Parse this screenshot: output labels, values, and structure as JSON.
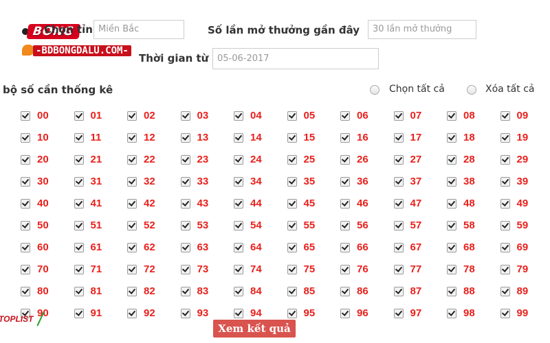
{
  "logo": {
    "brand": "BONG",
    "site": "-BDBONGDALU.COM-"
  },
  "form": {
    "province_label": "Chọn tỉnh",
    "province_value": "Miền Bắc",
    "draws_label": "Số lần mở thưởng gần đây",
    "draws_value": "30 lần mở thưởng",
    "from_label": "Thời gian từ",
    "from_value": "05-06-2017"
  },
  "numbers_section": {
    "title": "bộ số cần thống kê",
    "select_all": "Chọn tất cả",
    "clear_all": "Xóa tất cả"
  },
  "numbers": [
    "00",
    "01",
    "02",
    "03",
    "04",
    "05",
    "06",
    "07",
    "08",
    "09",
    "10",
    "11",
    "12",
    "13",
    "14",
    "15",
    "16",
    "17",
    "18",
    "19",
    "20",
    "21",
    "22",
    "23",
    "24",
    "25",
    "26",
    "27",
    "28",
    "29",
    "30",
    "31",
    "32",
    "33",
    "34",
    "35",
    "36",
    "37",
    "38",
    "39",
    "40",
    "41",
    "42",
    "43",
    "44",
    "45",
    "46",
    "47",
    "48",
    "49",
    "50",
    "51",
    "52",
    "53",
    "54",
    "55",
    "56",
    "57",
    "58",
    "59",
    "60",
    "61",
    "62",
    "63",
    "64",
    "65",
    "66",
    "67",
    "68",
    "69",
    "70",
    "71",
    "72",
    "73",
    "74",
    "75",
    "76",
    "77",
    "78",
    "79",
    "80",
    "81",
    "82",
    "83",
    "84",
    "85",
    "86",
    "87",
    "88",
    "89",
    "90",
    "91",
    "92",
    "93",
    "94",
    "95",
    "96",
    "97",
    "98",
    "99"
  ],
  "submit_label": "Xem kết quả",
  "watermark": "TOPLIST",
  "colors": {
    "number": "#e8201c",
    "button": "#d9534f",
    "brand": "#d6001c"
  }
}
